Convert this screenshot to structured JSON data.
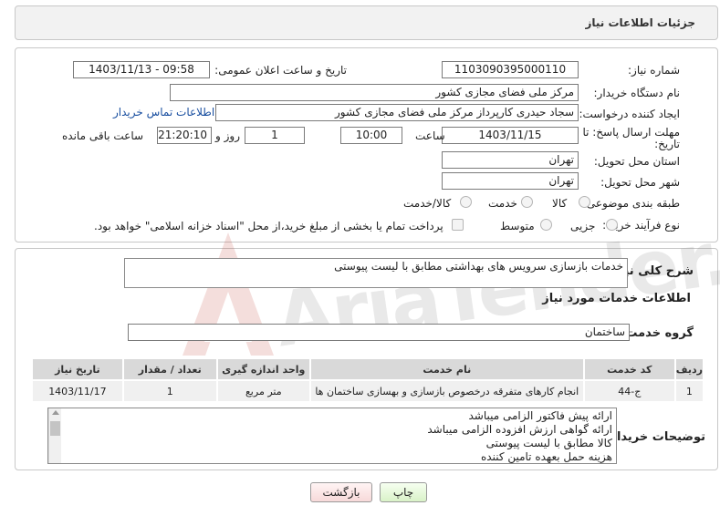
{
  "header": {
    "title": "جزئیات اطلاعات نیاز"
  },
  "form": {
    "need_number": {
      "label": "شماره نیاز:",
      "value": "1103090395000110"
    },
    "announce_datetime": {
      "label": "تاریخ و ساعت اعلان عمومی:",
      "value": "1403/11/13 - 09:58"
    },
    "buyer_org": {
      "label": "نام دستگاه خریدار:",
      "value": "مرکز ملی فضای مجازی کشور"
    },
    "requester": {
      "label": "ایجاد کننده درخواست:",
      "value": "سجاد حیدری کارپرداز مرکز ملی فضای مجازی کشور",
      "contact_link": "اطلاعات تماس خریدار"
    },
    "deadline": {
      "label_line1": "مهلت ارسال پاسخ: تا",
      "label_line2": "تاریخ:",
      "date": "1403/11/15",
      "time_label": "ساعت",
      "time": "10:00",
      "days": "1",
      "days_label": "روز و",
      "remaining": "21:20:10",
      "remaining_label": "ساعت باقی مانده"
    },
    "province": {
      "label": "استان محل تحویل:",
      "value": "تهران"
    },
    "city": {
      "label": "شهر محل تحویل:",
      "value": "تهران"
    },
    "category": {
      "label": "طبقه بندی موضوعی:",
      "options": [
        "کالا",
        "خدمت",
        "کالا/خدمت"
      ]
    },
    "purchase_type": {
      "label": "نوع فرآیند خرید :",
      "options": [
        "جزیی",
        "متوسط"
      ],
      "payment_note": "پرداخت تمام یا بخشی از مبلغ خرید،از محل \"اسناد خزانه اسلامی\" خواهد بود."
    }
  },
  "details": {
    "summary_label": "شرح کلی نیاز:",
    "summary_value": "خدمات بازسازی سرویس های بهداشتی مطابق با لیست پیوستی",
    "services_title": "اطلاعات خدمات مورد نیاز",
    "service_group_label": "گروه خدمت:",
    "service_group_value": "ساختمان",
    "table": {
      "headers": [
        "ردیف",
        "کد خدمت",
        "نام خدمت",
        "واحد اندازه گیری",
        "تعداد / مقدار",
        "تاریخ نیاز"
      ],
      "rows": [
        [
          "1",
          "ج-44",
          "انجام کارهای متفرقه درخصوص بازسازی و بهسازی ساختمان ها",
          "متر مربع",
          "1",
          "1403/11/17"
        ]
      ]
    },
    "buyer_notes_label": "توضیحات خریدار:",
    "buyer_notes_lines": [
      "ارائه پیش فاکتور الزامی میباشد",
      "ارائه گواهی ارزش افزوده الزامی میباشد",
      "کالا مطابق با لیست پیوستی",
      "هزینه حمل بعهده تامین کننده"
    ]
  },
  "buttons": {
    "print": "چاپ",
    "back": "بازگشت"
  },
  "watermark": {
    "text": "AriaTender.net"
  },
  "colors": {
    "link": "#1a4fa0",
    "watermark": "#c0392b"
  }
}
